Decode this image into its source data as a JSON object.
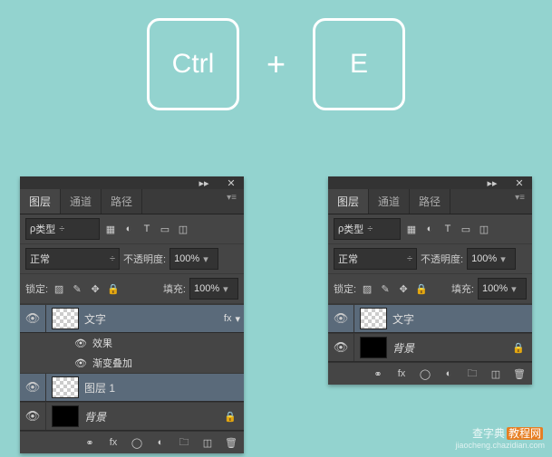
{
  "keyboard": {
    "key1": "Ctrl",
    "plus": "+",
    "key2": "E"
  },
  "panel": {
    "tabs": {
      "layers": "图层",
      "channels": "通道",
      "paths": "路径"
    },
    "filter": {
      "kind": "类型"
    },
    "blend": {
      "mode": "正常",
      "opacity_label": "不透明度:",
      "opacity": "100%"
    },
    "lock": {
      "label": "锁定:",
      "fill_label": "填充:",
      "fill": "100%"
    }
  },
  "left": {
    "layers": {
      "text": "文字",
      "fx": "fx",
      "effects": "效果",
      "gradient": "渐变叠加",
      "layer1": "图层 1",
      "bg": "背景"
    }
  },
  "right": {
    "layers": {
      "text": "文字",
      "bg": "背景"
    }
  },
  "watermark": {
    "main1": "查字典",
    "main2": "教程网",
    "sub": "jiaocheng.chazidian.com"
  }
}
